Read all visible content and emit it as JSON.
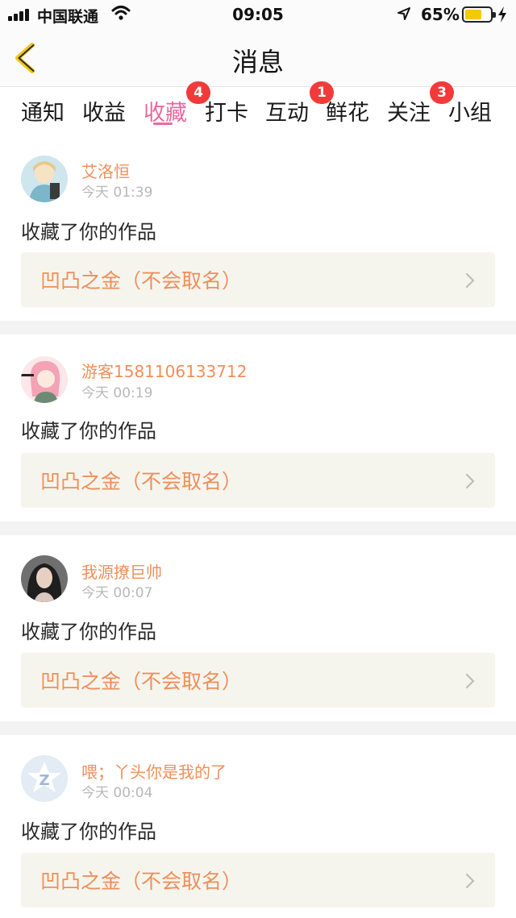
{
  "status_bar": {
    "carrier": "中国联通",
    "time": "09:05",
    "battery_percent": "65%",
    "battery_level": 0.65,
    "icons": [
      "signal-icon",
      "wifi-icon",
      "location-arrow-icon",
      "battery-icon",
      "charging-bolt-icon"
    ]
  },
  "nav": {
    "title": "消息",
    "back_icon": "chevron-left-icon"
  },
  "tabs": [
    {
      "label": "通知",
      "badge": ""
    },
    {
      "label": "收益",
      "badge": ""
    },
    {
      "label": "收藏",
      "badge": "4",
      "active": true
    },
    {
      "label": "打卡",
      "badge": ""
    },
    {
      "label": "互动",
      "badge": "1"
    },
    {
      "label": "鲜花",
      "badge": ""
    },
    {
      "label": "关注",
      "badge": "3"
    },
    {
      "label": "小组",
      "badge": ""
    }
  ],
  "items": [
    {
      "user": "艾洛恒",
      "time": "今天 01:39",
      "action": "收藏了你的作品",
      "work": "凹凸之金（不会取名）"
    },
    {
      "user": "游客1581106133712",
      "time": "今天 00:19",
      "action": "收藏了你的作品",
      "work": "凹凸之金（不会取名）"
    },
    {
      "user": "我源撩巨帅",
      "time": "今天 00:07",
      "action": "收藏了你的作品",
      "work": "凹凸之金（不会取名）"
    },
    {
      "user": "喂；丫头你是我的了",
      "time": "今天 00:04",
      "action": "收藏了你的作品",
      "work": "凹凸之金（不会取名）"
    }
  ],
  "colors": {
    "accent_pink": "#e86aa0",
    "name_orange": "#ef8f5b",
    "badge_red": "#f23a3a",
    "link_bg": "#f6f5ed",
    "back_arrow_yellow": "#f5c518"
  }
}
